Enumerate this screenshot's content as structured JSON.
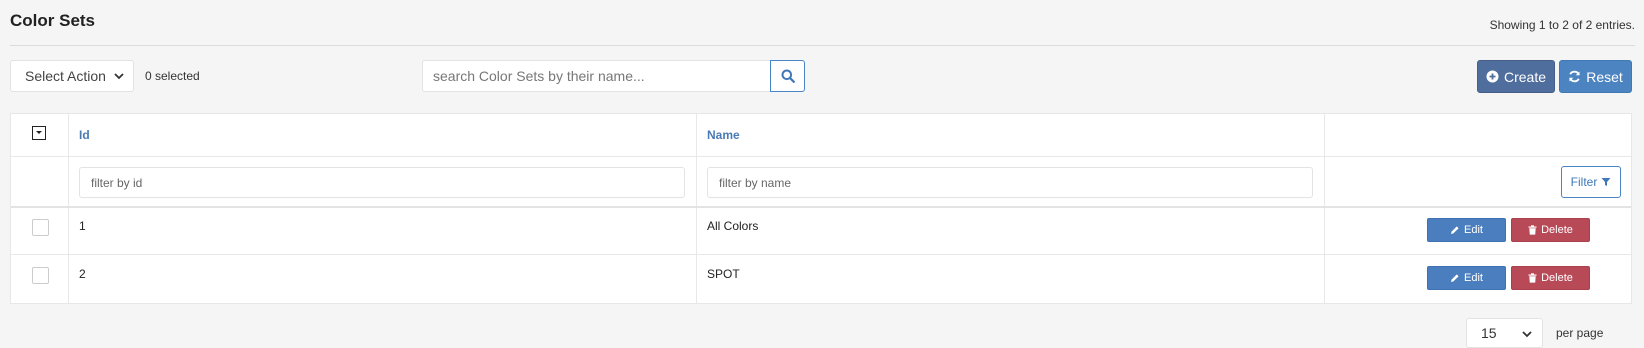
{
  "header": {
    "title": "Color Sets",
    "showing": "Showing 1 to 2 of 2 entries."
  },
  "toolbar": {
    "select_action": "Select Action",
    "selected_count": "0 selected",
    "search_placeholder": "search Color Sets by their name...",
    "create_label": "Create",
    "reset_label": "Reset"
  },
  "table": {
    "columns": [
      "Id",
      "Name"
    ],
    "filters": {
      "id_placeholder": "filter by id",
      "name_placeholder": "filter by name",
      "button_label": "Filter"
    },
    "rows": [
      {
        "id": "1",
        "name": "All Colors",
        "edit_label": "Edit",
        "delete_label": "Delete"
      },
      {
        "id": "2",
        "name": "SPOT",
        "edit_label": "Edit",
        "delete_label": "Delete"
      }
    ]
  },
  "pagination": {
    "per_page_value": "15",
    "per_page_label": "per page"
  },
  "colors": {
    "create_button": "#4f6e9e",
    "reset_button": "#4c84c1",
    "edit_button": "#4a7ebf",
    "delete_button": "#b84a57",
    "link_header": "#4a7bb4"
  },
  "icons": {
    "search": "search-icon",
    "create": "plus-circle-icon",
    "reset": "refresh-icon",
    "filter": "filter-icon",
    "edit": "pencil-icon",
    "delete": "trash-icon",
    "dropdown": "chevron-down-icon"
  }
}
